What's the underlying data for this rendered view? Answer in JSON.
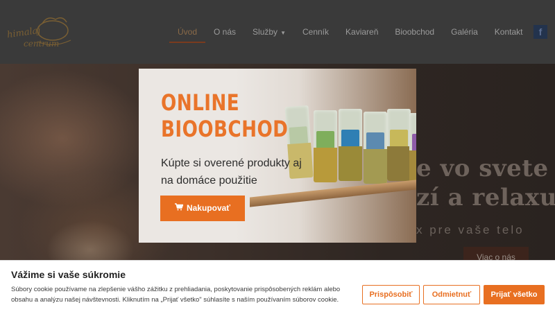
{
  "header": {
    "logo_line1": "himalaj",
    "logo_line2": "centrum",
    "nav": [
      {
        "label": "Úvod"
      },
      {
        "label": "O nás"
      },
      {
        "label": "Služby"
      },
      {
        "label": "Cenník"
      },
      {
        "label": "Kaviareň"
      },
      {
        "label": "Bioobchod"
      },
      {
        "label": "Galéria"
      },
      {
        "label": "Kontakt"
      }
    ],
    "facebook": "f"
  },
  "hero": {
    "heading_line1": "e vo svete",
    "heading_line2": "zí a relaxu",
    "subtitle": "x pre vaše telo",
    "button": "Viac o nás"
  },
  "popup": {
    "title_line1": "ONLINE",
    "title_line2": "BIOOBCHOD",
    "text": "Kúpte si overené produkty aj na domáce použitie",
    "button": "Nakupovať",
    "button_icon": "shopping-cart-icon"
  },
  "cookie": {
    "title": "Vážime si vaše súkromie",
    "text": "Súbory cookie používame na zlepšenie vášho zážitku z prehliadania, poskytovanie prispôsobených reklám alebo obsahu a analýzu našej návštevnosti. Kliknutím na „Prijať všetko\" súhlasíte s naším používaním súborov cookie.",
    "btn_customize": "Prispôsobiť",
    "btn_reject": "Odmietnuť",
    "btn_accept": "Prijať všetko"
  },
  "colors": {
    "accent": "#e86f21",
    "overlay": "#3a3a3a"
  }
}
